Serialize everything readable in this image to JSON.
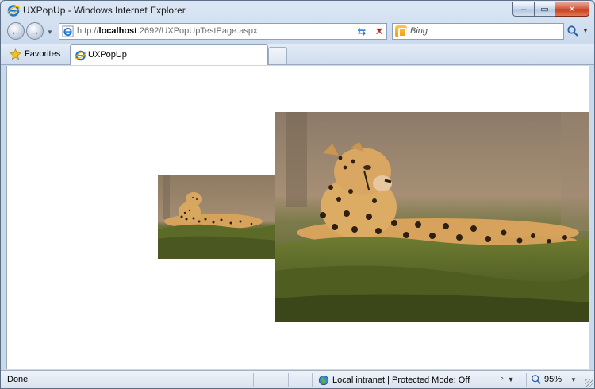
{
  "window": {
    "title": "UXPopUp - Windows Internet Explorer",
    "caption_buttons": {
      "minimize": "–",
      "maximize": "▭",
      "close": "✕"
    }
  },
  "address_bar": {
    "url_prefix": "http://",
    "url_host": "localhost",
    "url_rest": ":2692/UXPopUpTestPage.aspx"
  },
  "search": {
    "placeholder": "Bing"
  },
  "favorites": {
    "label": "Favorites"
  },
  "tabs": [
    {
      "label": "UXPopUp"
    }
  ],
  "content": {
    "images": [
      {
        "name": "cheetah-thumbnail",
        "subject": "cheetah lying on grass"
      },
      {
        "name": "cheetah-popup-enlarged",
        "subject": "cheetah lying on grass"
      }
    ]
  },
  "status": {
    "text": "Done",
    "zone": "Local intranet | Protected Mode: Off",
    "zoom": "95%"
  },
  "colors": {
    "chrome_blue": "#c9d9ec",
    "close_red": "#c5391a",
    "grass": "#5e6b2c",
    "cheetah": "#d8a45c"
  }
}
